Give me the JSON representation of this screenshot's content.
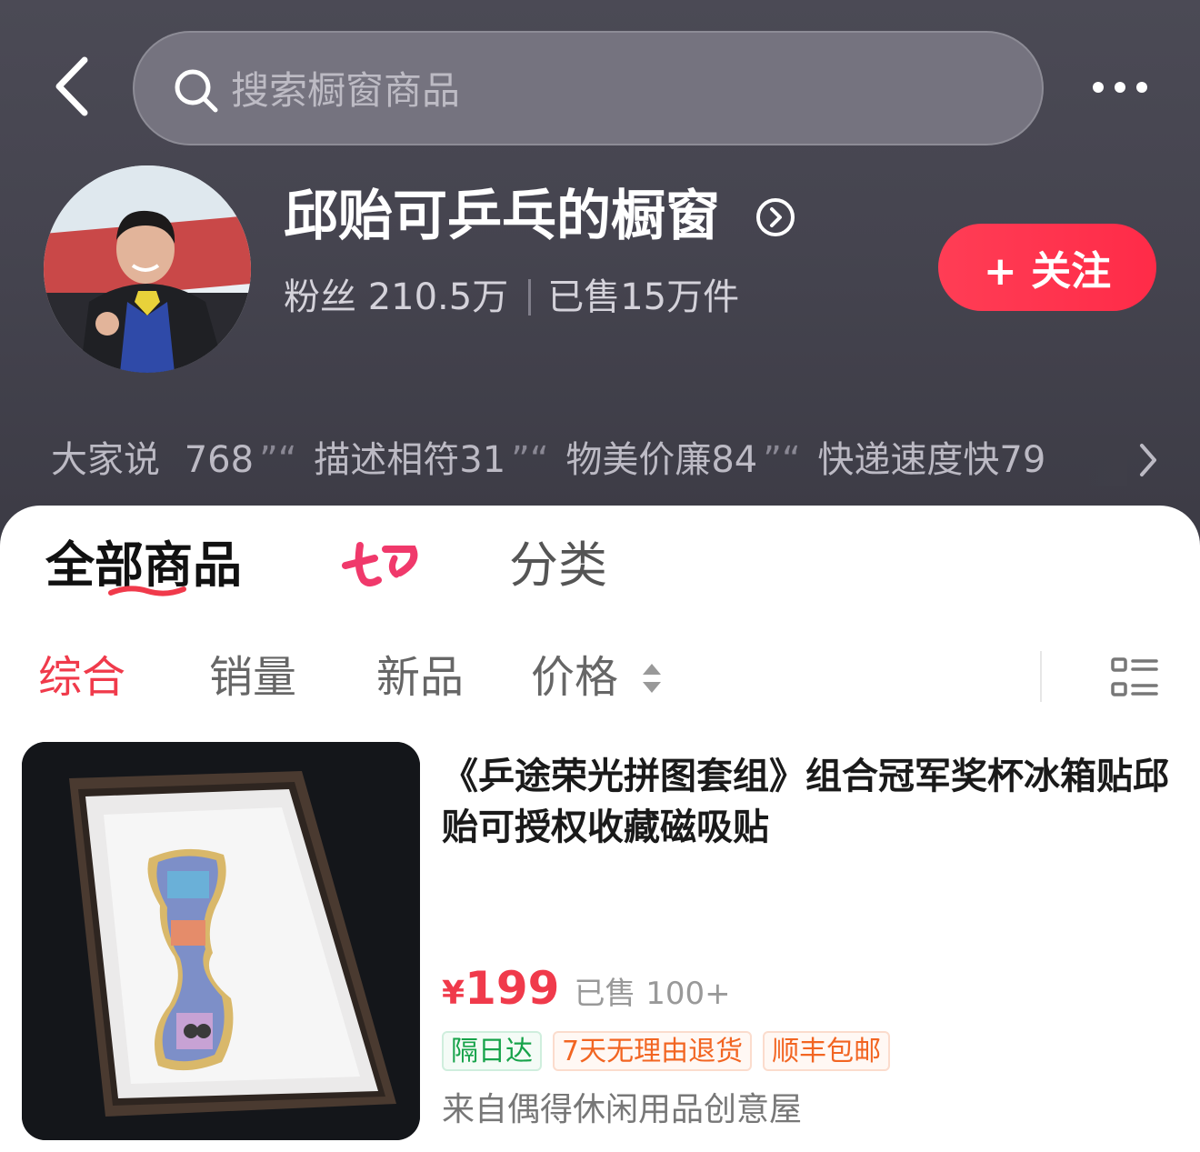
{
  "search": {
    "placeholder": "搜索橱窗商品"
  },
  "shop": {
    "name": "邱贻可乒乓的橱窗",
    "fans": "粉丝 210.5万",
    "sold": "已售15万件",
    "follow_label": "+ 关注"
  },
  "reviews": {
    "lead": "大家说",
    "items": [
      {
        "text": "768"
      },
      {
        "text": "描述相符31"
      },
      {
        "text": "物美价廉84"
      },
      {
        "text": "快递速度快79"
      }
    ]
  },
  "tabs": {
    "all": "全部商品",
    "promo": "七夕",
    "category": "分类"
  },
  "sort": {
    "comprehensive": "综合",
    "sales": "销量",
    "new": "新品",
    "price": "价格"
  },
  "product": {
    "title": "《乒途荣光拼图套组》组合冠军奖杯冰箱贴邱贻可授权收藏磁吸贴",
    "price_symbol": "¥",
    "price": "199",
    "sold": "已售 100+",
    "badges": [
      "隔日达",
      "7天无理由退货",
      "顺丰包邮"
    ],
    "shop_from": "来自偶得休闲用品创意屋"
  },
  "colors": {
    "accent": "#f03a4b",
    "header_bg": "#45444f",
    "follow": "#ff3450"
  }
}
